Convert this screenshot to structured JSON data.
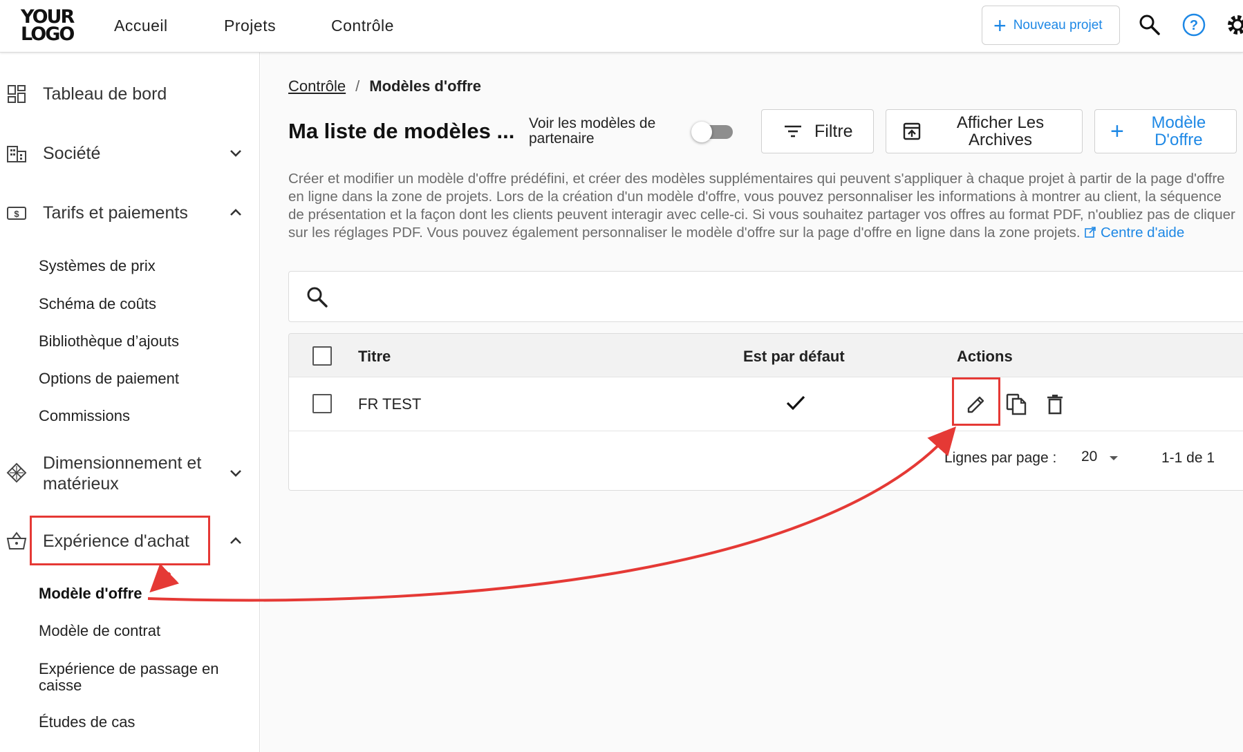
{
  "header": {
    "logo_line1": "YOUR",
    "logo_line2": "LOGO",
    "nav": [
      "Accueil",
      "Projets",
      "Contrôle"
    ],
    "new_project_label": "Nouveau projet"
  },
  "sidebar": {
    "main_items": [
      {
        "label": "Tableau de bord",
        "icon": "dashboard-icon"
      },
      {
        "label": "Société",
        "icon": "building-icon"
      },
      {
        "label": "Tarifs et paiements",
        "icon": "payments-icon"
      },
      {
        "label": "Dimensionnement et matérieux",
        "icon": "materials-icon"
      },
      {
        "label": "Expérience d'achat",
        "icon": "basket-icon"
      }
    ],
    "tarifs_sub": [
      "Systèmes de prix",
      "Schéma de coûts",
      "Bibliothèque d’ajouts",
      "Options de paiement",
      "Commissions"
    ],
    "achat_sub": [
      "Modèle d'offre",
      "Modèle de contrat",
      "Expérience de passage en caisse",
      "Études de cas"
    ]
  },
  "breadcrumb": {
    "parent": "Contrôle",
    "separator": "/",
    "current": "Modèles d'offre"
  },
  "page": {
    "title": "Ma liste de modèles ...",
    "toggle_label": "Voir les modèles de partenaire",
    "toggle_on": false,
    "filter_label": "Filtre",
    "archives_label": "Afficher Les Archives",
    "new_model_label": "Modèle D'offre",
    "description": "Créer et modifier un modèle d'offre prédéfini, et créer des modèles supplémentaires qui peuvent s'appliquer à chaque projet à partir de la page d'offre en ligne dans la zone de projets. Lors de la création d'un modèle d'offre, vous pouvez personnaliser les informations à montrer au client, la séquence de présentation et la façon dont les clients peuvent interagir avec celle-ci. Si vous souhaitez partager vos offres au format PDF, n'oubliez pas de cliquer sur les réglages PDF. Vous pouvez également personnaliser le modèle d'offre sur la page d'offre en ligne dans la zone projets.",
    "help_link": "Centre d'aide"
  },
  "search": {
    "placeholder": ""
  },
  "table": {
    "columns": [
      "Titre",
      "Est par défaut",
      "Actions"
    ],
    "rows": [
      {
        "title": "FR TEST",
        "is_default": true
      }
    ],
    "rows_per_page_label": "Lignes par page :",
    "rows_per_page": "20",
    "range": "1-1 de 1"
  },
  "colors": {
    "accent": "#1e88e5",
    "highlight": "#e53935"
  }
}
